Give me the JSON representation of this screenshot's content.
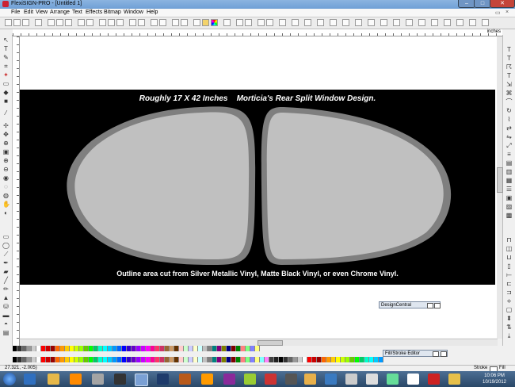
{
  "window": {
    "title": "FlexiSIGN-PRO - [Untitled 1]"
  },
  "menu": [
    "File",
    "Edit",
    "View",
    "Arrange",
    "Text",
    "Effects",
    "Bitmap",
    "Window",
    "Help"
  ],
  "ruler": {
    "units": "inches"
  },
  "artwork": {
    "title": "Roughly 17 X 42 Inches    Morticia's Rear Split Window Design.",
    "footer": "Outline area cut from Silver Metallic Vinyl, Matte Black Vinyl, or even Chrome Vinyl."
  },
  "panels": {
    "design_central": "DesignCentral",
    "fill_stroke": "Fill/Stroke Editor"
  },
  "status": {
    "coords": "27.321,   -2.005)",
    "stroke": "Stroke",
    "fill": "Fill"
  },
  "clock": {
    "time": "10:06 PM",
    "date": "10/19/2012"
  },
  "palette_colors": [
    "#000000",
    "#333333",
    "#666666",
    "#999999",
    "#cccccc",
    "#ffffff",
    "#ff0000",
    "#cc0000",
    "#990000",
    "#ff6600",
    "#ff9900",
    "#ffcc00",
    "#ffff00",
    "#ccff00",
    "#99ff00",
    "#66cc00",
    "#00ff00",
    "#00cc66",
    "#00ffcc",
    "#00ffff",
    "#00ccff",
    "#0099ff",
    "#0066ff",
    "#0000ff",
    "#3300cc",
    "#6600cc",
    "#9900ff",
    "#cc00ff",
    "#ff00ff",
    "#ff0099",
    "#ff3366",
    "#cc3366",
    "#996633",
    "#cc9966",
    "#663300",
    "#ffcccc",
    "#ccffcc",
    "#ccccff",
    "#ffffcc",
    "#ccffff",
    "#c0c0c0",
    "#808080",
    "#008080",
    "#800080",
    "#808000",
    "#000080",
    "#800000",
    "#008000",
    "#ff8080",
    "#80ff80",
    "#8080ff",
    "#ffff80",
    "#80ffff",
    "#ff80ff",
    "#404040",
    "#202020"
  ],
  "colors": {
    "artwork_bg": "#000000",
    "window_fill": "#c0c0c0",
    "window_outline": "#7f7f7f"
  }
}
